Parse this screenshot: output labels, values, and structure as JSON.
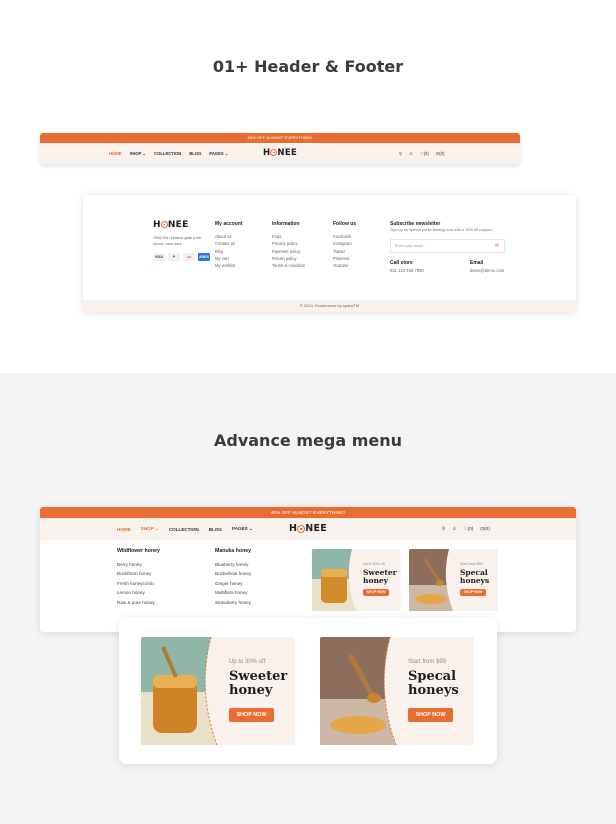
{
  "titles": {
    "header_footer": "01+ Header & Footer",
    "mega_menu": "Advance mega menu"
  },
  "header": {
    "promo": "40% OFF ALMOST EVERYTHING!",
    "nav": [
      "HOME",
      "SHOP",
      "COLLECTION",
      "BLOG",
      "PAGES"
    ],
    "shop_chevron": "⌄",
    "pages_chevron": "⌄",
    "logo_h": "H",
    "logo_rest": "NEE",
    "wishlist_count": "(0)",
    "cart_count": "(0)",
    "search_icon": "⚲",
    "user_icon": "♙",
    "heart_icon": "♡",
    "bag_icon": "⊡"
  },
  "footer": {
    "address": "7862 Rd reliance gate park chock, new york",
    "payments": [
      "VISA",
      "P",
      "●●",
      "AMEX"
    ],
    "columns": [
      {
        "title": "My account",
        "links": [
          "About us",
          "Contact us",
          "Blog",
          "My cart",
          "My wishlist"
        ]
      },
      {
        "title": "Information",
        "links": [
          "Faqs",
          "Privacy policy",
          "Payment policy",
          "Return policy",
          "Terms & condition"
        ]
      },
      {
        "title": "Follow us",
        "links": [
          "Facebook",
          "Instagram",
          "Twitter",
          "Pinterest",
          "Youtube"
        ]
      }
    ],
    "newsletter_title": "Subscribe newsletter",
    "newsletter_text": "Sign up for special perks starting now with a 10% off coupon!",
    "email_placeholder": "Enter your email...",
    "send_icon": "✉",
    "call_label": "Call store",
    "call_value": "021 123 456 7890",
    "email_label": "Email",
    "email_value": "demo@demo.com",
    "copyright": "© 2024, Ecommerce by spacyTM"
  },
  "mega": {
    "col1_title": "Wildflower honey",
    "col1": [
      "Berry honey",
      "Buckthorn honey",
      "Fresh honeycomb",
      "Lemon honey",
      "Raw & pure honey"
    ],
    "col2_title": "Manuka honey",
    "col2": [
      "Blueberry honey",
      "Buckwheat honey",
      "Ginger honey",
      "Multiflora honey",
      "Strawberry honey"
    ]
  },
  "promos": [
    {
      "eyebrow": "Up to 30% off",
      "title_line1": "Sweeter",
      "title_line2": "honey",
      "button": "SHOP NOW"
    },
    {
      "eyebrow": "Start from $99",
      "title_line1": "Specal",
      "title_line2": "honeys",
      "button": "SHOP NOW"
    }
  ],
  "colors": {
    "accent": "#e86d33",
    "cream": "#f8f1ec"
  }
}
